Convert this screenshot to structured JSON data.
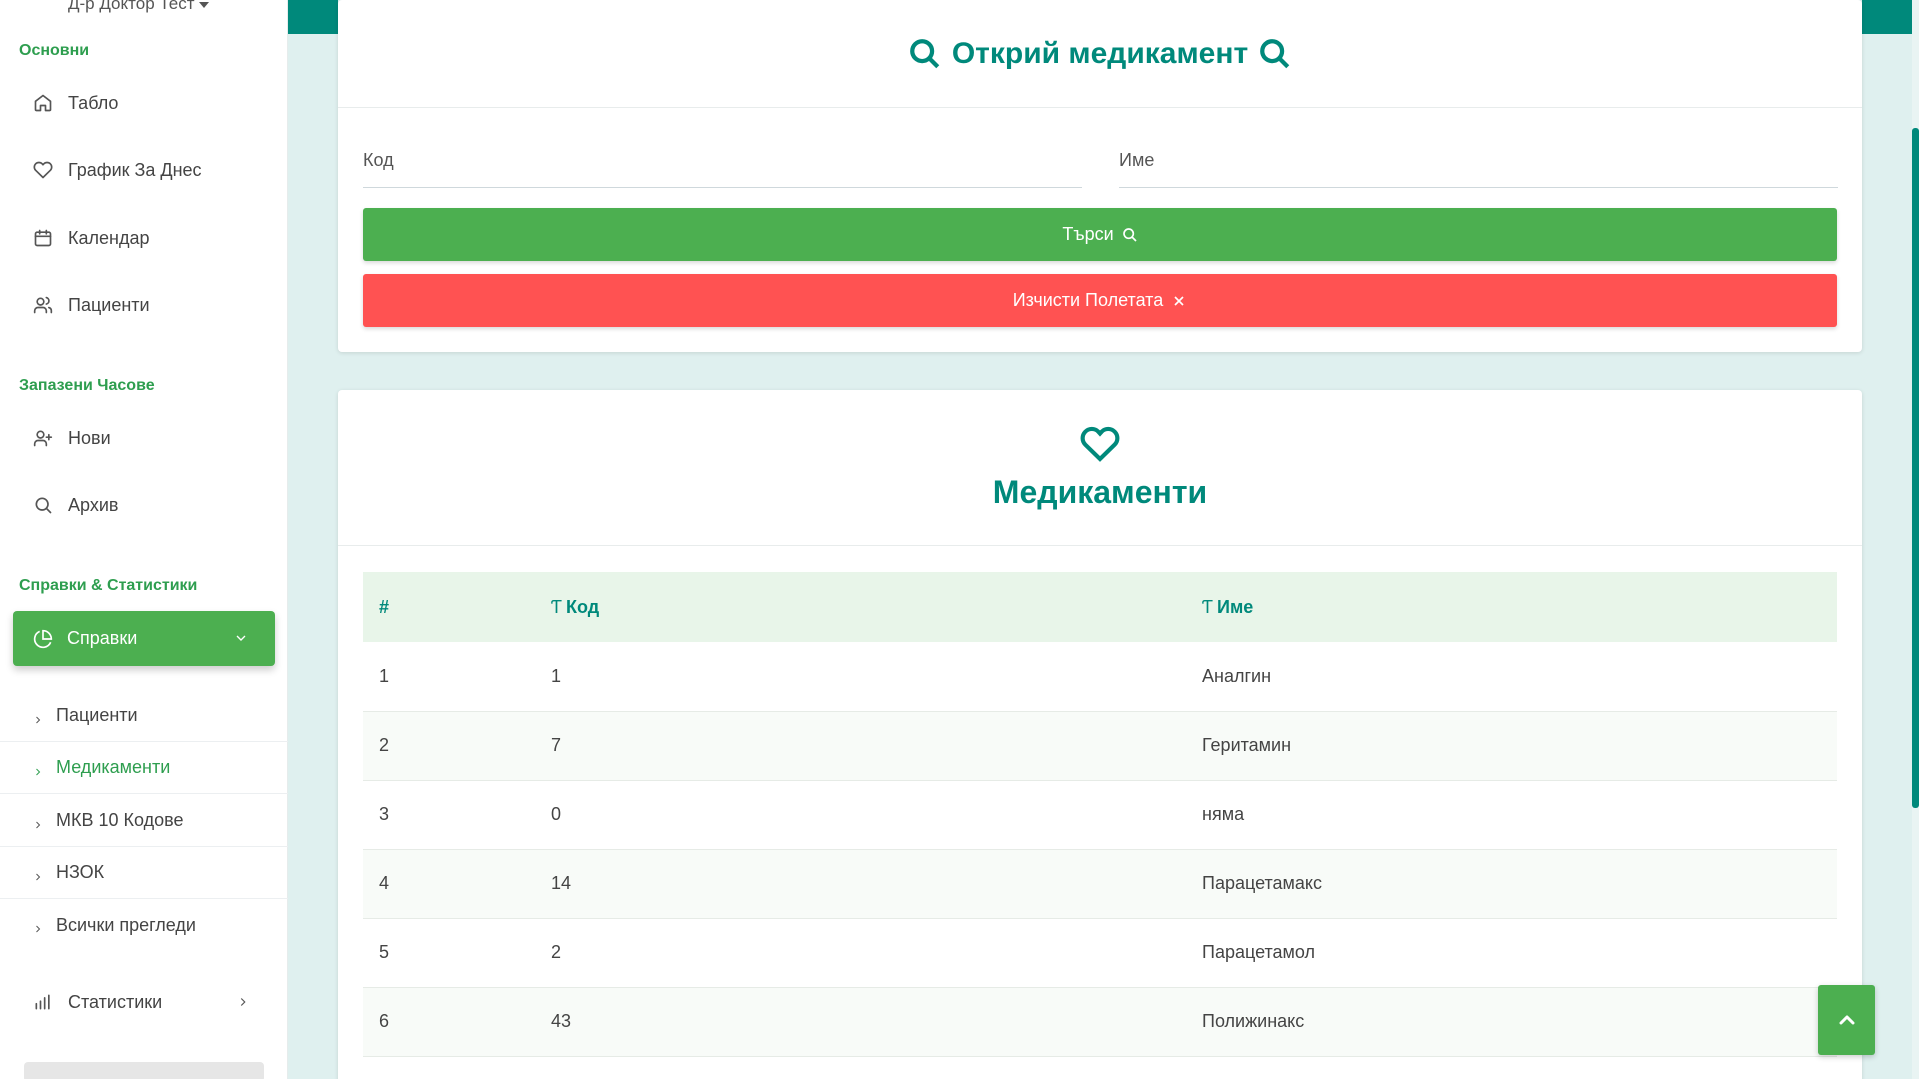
{
  "user": {
    "name": "Д-р Доктор Тест"
  },
  "sidebar": {
    "sections": {
      "main": "Основни",
      "appointments": "Запазени Часове",
      "reports": "Справки & Статистики"
    },
    "main_items": [
      {
        "label": "Табло",
        "icon": "home-icon"
      },
      {
        "label": "График За Днес",
        "icon": "heart-icon"
      },
      {
        "label": "Календар",
        "icon": "calendar-icon"
      },
      {
        "label": "Пациенти",
        "icon": "users-icon"
      }
    ],
    "appointment_items": [
      {
        "label": "Нови",
        "icon": "user-plus-icon"
      },
      {
        "label": "Архив",
        "icon": "search-icon"
      }
    ],
    "reports_active": {
      "label": "Справки",
      "icon": "pie-chart-icon"
    },
    "reports_sub": [
      {
        "label": "Пациенти",
        "active": false
      },
      {
        "label": "Медикаменти",
        "active": true
      },
      {
        "label": "МКВ 10 Кодове",
        "active": false
      },
      {
        "label": "НЗОК",
        "active": false
      },
      {
        "label": "Всички прегледи",
        "active": false
      }
    ],
    "statistics": {
      "label": "Статистики",
      "icon": "bar-chart-icon"
    }
  },
  "search_card": {
    "title": "Открий медикамент",
    "code_label": "Код",
    "name_label": "Име",
    "code_value": "",
    "name_value": "",
    "search_button": "Търси",
    "clear_button": "Изчисти Полетата"
  },
  "results_card": {
    "title": "Медикаменти",
    "columns": {
      "num": "#",
      "code": "Код",
      "name": "Име",
      "type_icon": "Ƭ"
    },
    "rows": [
      {
        "num": "1",
        "code": "1",
        "name": "Аналгин"
      },
      {
        "num": "2",
        "code": "7",
        "name": "Геритамин"
      },
      {
        "num": "3",
        "code": "0",
        "name": "няма"
      },
      {
        "num": "4",
        "code": "14",
        "name": "Парацетамакс"
      },
      {
        "num": "5",
        "code": "2",
        "name": "Парацетамол"
      },
      {
        "num": "6",
        "code": "43",
        "name": "Полижинакс"
      }
    ]
  },
  "colors": {
    "teal": "#00897b",
    "green": "#4caf50",
    "red": "#ff5252",
    "section_green": "#2e9e4f"
  }
}
